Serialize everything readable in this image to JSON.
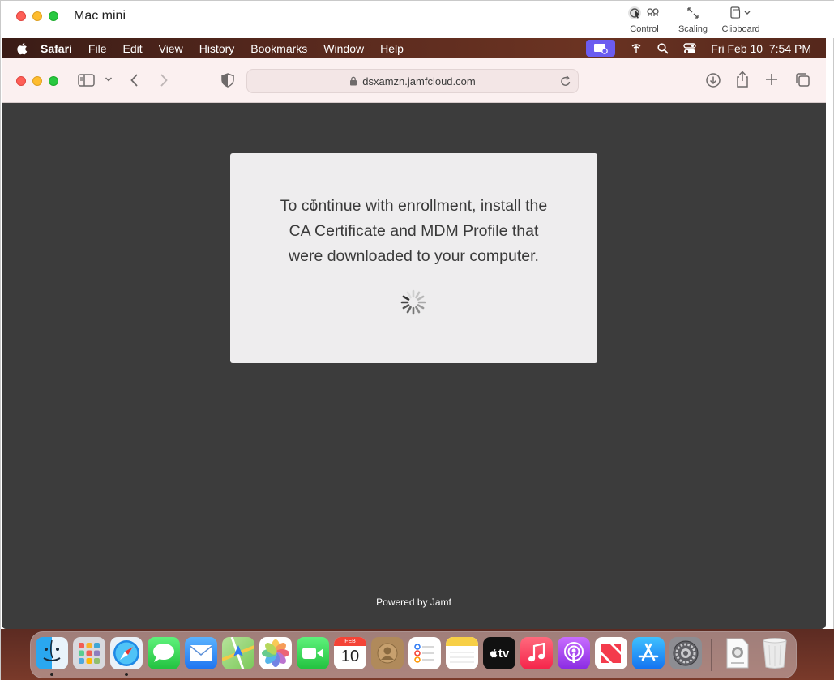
{
  "outer_window": {
    "title": "Mac mini",
    "tools": [
      {
        "label": "Control",
        "icon": "control-icon"
      },
      {
        "label": "Scaling",
        "icon": "scaling-icon"
      },
      {
        "label": "Clipboard",
        "icon": "clipboard-icon"
      }
    ]
  },
  "menubar": {
    "app": "Safari",
    "items": [
      "File",
      "Edit",
      "View",
      "History",
      "Bookmarks",
      "Window",
      "Help"
    ],
    "clock": "Fri Feb 10  7:54 PM"
  },
  "safari": {
    "url": "dsxamzn.jamfcloud.com"
  },
  "page": {
    "message_lines": [
      "To continue with enrollment, install the",
      "CA Certificate and MDM Profile that",
      "were downloaded to your computer."
    ],
    "footer": "Powered by Jamf"
  },
  "dock": {
    "calendar_month": "FEB",
    "calendar_day": "10",
    "tv_label": "tv",
    "apps": [
      "Finder",
      "Launchpad",
      "Safari",
      "Messages",
      "Mail",
      "Maps",
      "Photos",
      "FaceTime",
      "Calendar",
      "Contacts",
      "Reminders",
      "Notes",
      "TV",
      "Music",
      "Podcasts",
      "News",
      "App Store",
      "System Preferences",
      "Document",
      "Trash"
    ]
  },
  "colors": {
    "page_bg": "#3c3c3c",
    "card_bg": "#eeedee",
    "menubar_accent": "#6b5cf0",
    "toolbar_bg": "#fbf0f0"
  }
}
